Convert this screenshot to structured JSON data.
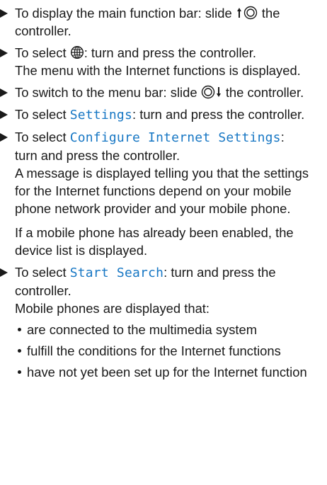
{
  "steps": [
    {
      "pre": "To display the main function bar: slide ",
      "post": " the controller."
    },
    {
      "pre": "To select ",
      "post": ": turn and press the controller.",
      "line2": "The menu with the Internet functions is displayed."
    },
    {
      "pre": "To switch to the menu bar: slide ",
      "post": " the controller."
    },
    {
      "pre": "To select ",
      "kw": "Settings",
      "post": ": turn and press the controller."
    },
    {
      "pre": "To select ",
      "kw": "Configure Internet Settings",
      "post": ":",
      "line2": "turn and press the controller.",
      "line3": "A message is displayed telling you that the settings for the Internet functions depend on your mobile phone network provider and your mobile phone.",
      "para": "If a mobile phone has already been enabled, the device list is displayed."
    },
    {
      "pre": "To select ",
      "kw": "Start Search",
      "post": ": turn and press the controller.",
      "line2": "Mobile phones are displayed that:"
    }
  ],
  "bullets": [
    "are connected to the multimedia system",
    "fulfill the conditions for the Internet functions",
    "have not yet been set up for the Internet function"
  ],
  "icons": {
    "slide_up_controller": "controller-slide-up-icon",
    "internet": "globe-icon",
    "slide_down_controller": "controller-slide-down-icon",
    "step_marker": "triangle-arrow-icon"
  }
}
